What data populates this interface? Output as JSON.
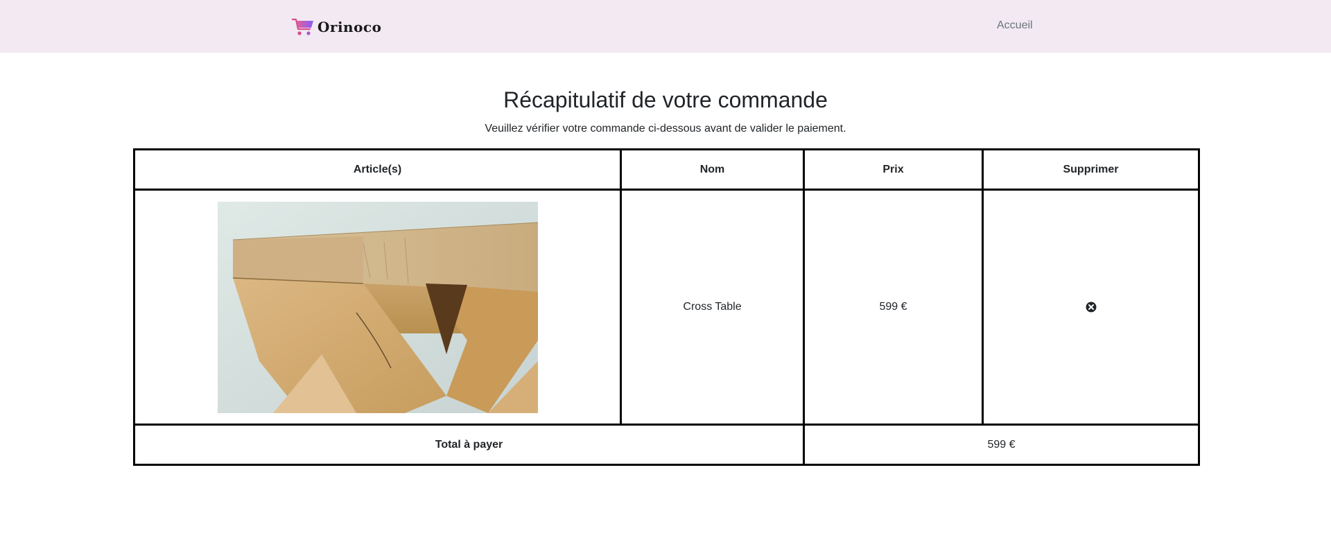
{
  "navbar": {
    "brand_name": "Orinoco",
    "links": [
      {
        "label": "Accueil"
      }
    ]
  },
  "page": {
    "title": "Récapitulatif de votre commande",
    "subtitle": "Veuillez vérifier votre commande ci-dessous avant de valider le paiement."
  },
  "table": {
    "headers": [
      "Article(s)",
      "Nom",
      "Prix",
      "Supprimer"
    ],
    "rows": [
      {
        "name": "Cross Table",
        "price": "599 €",
        "image": "oak-cross-table-photo",
        "remove_icon": "times-circle-icon"
      }
    ],
    "total_label": "Total à payer",
    "total_value": "599 €"
  },
  "colors": {
    "navbar_bg": "#f2e9f2",
    "nav_link": "#6c757d",
    "brand_gradient": [
      "#e0609a",
      "#8b5cf6"
    ]
  }
}
